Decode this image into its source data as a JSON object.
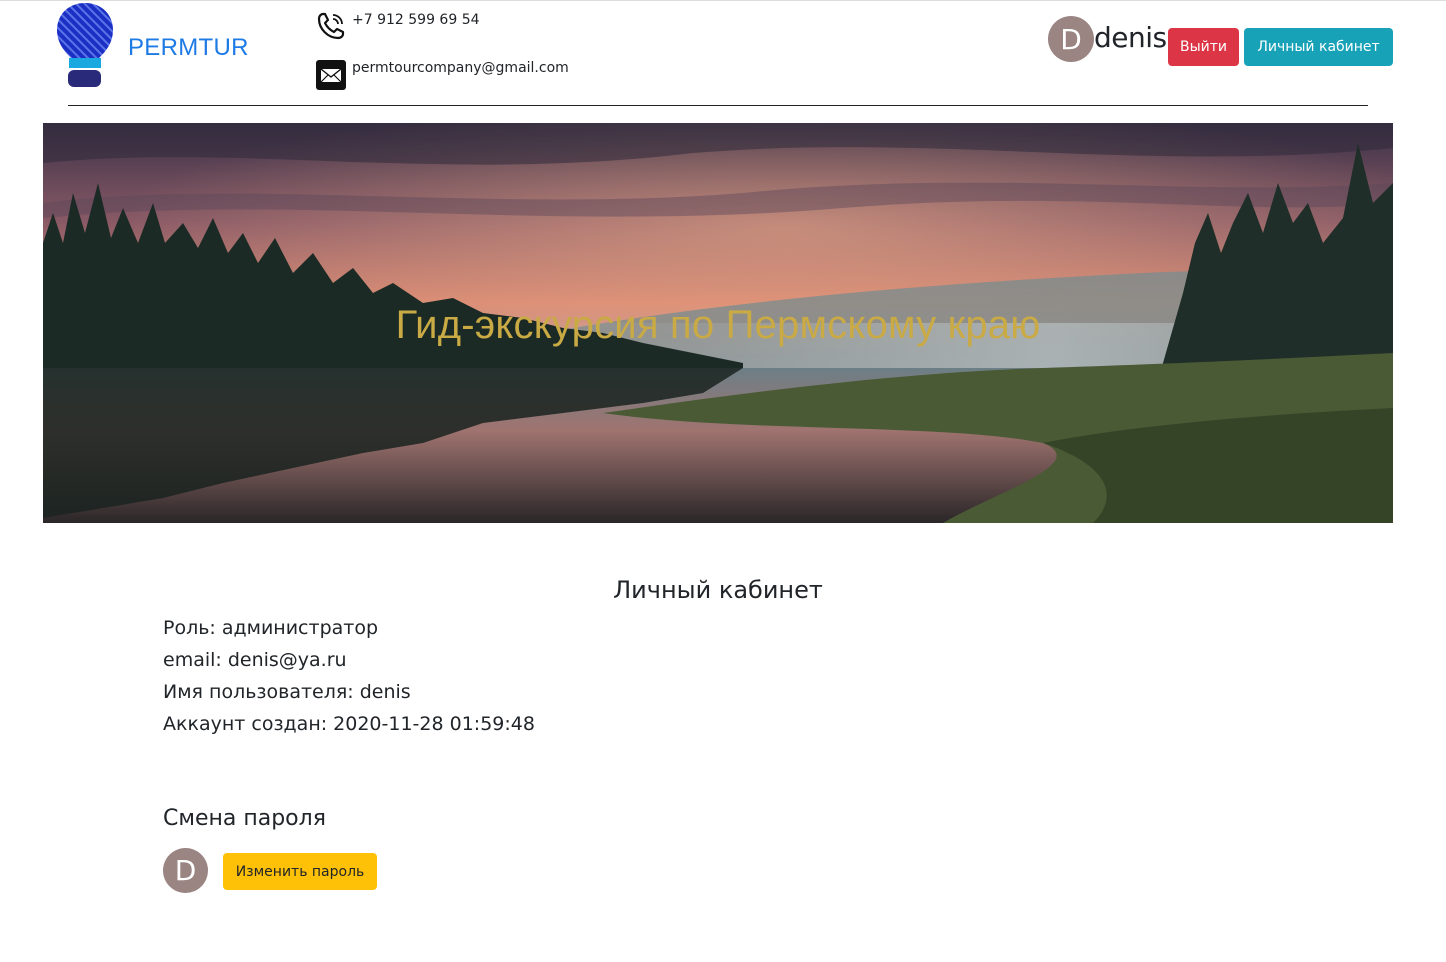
{
  "header": {
    "brand": "PERMTUR",
    "phone": "+7 912 599 69 54",
    "email": "permtourcompany@gmail.com",
    "user": {
      "avatar_letter": "D",
      "username": "denis"
    },
    "logout_label": "Выйти",
    "cabinet_label": "Личный кабинет"
  },
  "hero": {
    "title": "Гид-экскурсия по Пермскому краю"
  },
  "profile": {
    "title": "Личный кабинет",
    "role": {
      "label": "Роль:",
      "value": "администратор"
    },
    "email": {
      "label": "email:",
      "value": "denis@ya.ru"
    },
    "username": {
      "label": "Имя пользователя:",
      "value": "denis"
    },
    "created": {
      "label": "Аккаунт создан:",
      "value": "2020-11-28 01:59:48"
    }
  },
  "password": {
    "title": "Смена пароля",
    "avatar_letter": "D",
    "button_label": "Изменить пароль"
  },
  "colors": {
    "brand": "#1e7be6",
    "danger": "#dc3545",
    "info": "#17a2b8",
    "warning": "#ffc107",
    "avatar": "#9a8583",
    "hero_title": "#c9aa45"
  },
  "icons": {
    "logo": "balloon-logo-icon",
    "phone": "phone-icon",
    "mail": "mail-icon"
  }
}
